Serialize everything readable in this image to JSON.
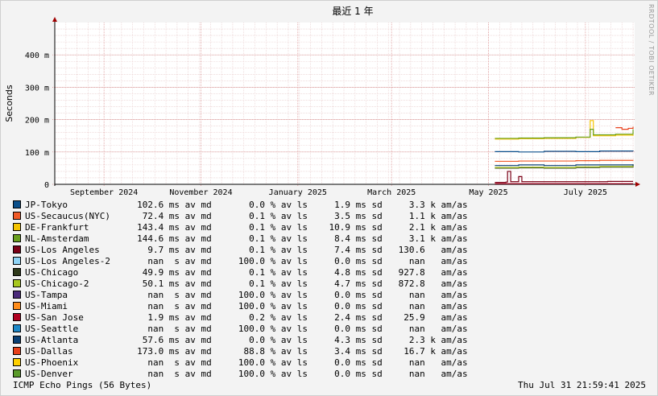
{
  "chart_data": {
    "type": "line",
    "title": "最近 1 年",
    "ylabel": "Seconds",
    "ylim": [
      0,
      0.5
    ],
    "ytick_labels": [
      "0",
      "100 m",
      "200 m",
      "300 m",
      "400 m"
    ],
    "ytick_values": [
      0,
      0.1,
      0.2,
      0.3,
      0.4
    ],
    "xlim": [
      "2024-08-01",
      "2025-08-01"
    ],
    "xtick_labels": [
      "September 2024",
      "November 2024",
      "January 2025",
      "March 2025",
      "May 2025",
      "July 2025"
    ],
    "xtick_dates": [
      "2024-09-01",
      "2024-11-01",
      "2025-01-01",
      "2025-03-01",
      "2025-05-01",
      "2025-07-01"
    ],
    "grid": true,
    "series": [
      {
        "name": "JP-Tokyo",
        "color": "#0b4f8a",
        "points": [
          [
            "2025-05-05",
            0.101
          ],
          [
            "2025-05-20",
            0.1
          ],
          [
            "2025-06-05",
            0.102
          ],
          [
            "2025-06-25",
            0.101
          ],
          [
            "2025-07-10",
            0.103
          ],
          [
            "2025-07-31",
            0.102
          ]
        ]
      },
      {
        "name": "US-Secaucus(NYC)",
        "color": "#f05a28",
        "points": [
          [
            "2025-05-05",
            0.071
          ],
          [
            "2025-05-20",
            0.072
          ],
          [
            "2025-06-05",
            0.072
          ],
          [
            "2025-06-25",
            0.073
          ],
          [
            "2025-07-10",
            0.074
          ],
          [
            "2025-07-31",
            0.073
          ]
        ]
      },
      {
        "name": "DE-Frankfurt",
        "color": "#f5c400",
        "points": [
          [
            "2025-05-05",
            0.14
          ],
          [
            "2025-05-20",
            0.141
          ],
          [
            "2025-06-05",
            0.142
          ],
          [
            "2025-06-25",
            0.145
          ],
          [
            "2025-07-04",
            0.197
          ],
          [
            "2025-07-06",
            0.15
          ],
          [
            "2025-07-20",
            0.152
          ],
          [
            "2025-07-31",
            0.15
          ]
        ]
      },
      {
        "name": "NL-Amsterdam",
        "color": "#6aa01e",
        "points": [
          [
            "2025-05-05",
            0.142
          ],
          [
            "2025-05-20",
            0.143
          ],
          [
            "2025-06-05",
            0.144
          ],
          [
            "2025-06-25",
            0.146
          ],
          [
            "2025-07-04",
            0.17
          ],
          [
            "2025-07-06",
            0.153
          ],
          [
            "2025-07-20",
            0.155
          ],
          [
            "2025-07-31",
            0.17
          ]
        ]
      },
      {
        "name": "US-Los Angeles",
        "color": "#7a0016",
        "points": [
          [
            "2025-05-05",
            0.006
          ],
          [
            "2025-05-12",
            0.007
          ],
          [
            "2025-05-13",
            0.04
          ],
          [
            "2025-05-15",
            0.008
          ],
          [
            "2025-05-20",
            0.024
          ],
          [
            "2025-05-22",
            0.008
          ],
          [
            "2025-06-15",
            0.008
          ],
          [
            "2025-07-15",
            0.009
          ],
          [
            "2025-07-31",
            0.009
          ]
        ]
      },
      {
        "name": "US-Los Angeles-2",
        "color": "#8fd3f5",
        "points": []
      },
      {
        "name": "US-Chicago",
        "color": "#2f3a1a",
        "points": [
          [
            "2025-05-05",
            0.05
          ],
          [
            "2025-05-20",
            0.051
          ],
          [
            "2025-06-05",
            0.05
          ],
          [
            "2025-06-25",
            0.052
          ],
          [
            "2025-07-10",
            0.053
          ],
          [
            "2025-07-31",
            0.062
          ]
        ]
      },
      {
        "name": "US-Chicago-2",
        "color": "#a8c81e",
        "points": [
          [
            "2025-05-05",
            0.052
          ],
          [
            "2025-05-20",
            0.053
          ],
          [
            "2025-06-05",
            0.052
          ],
          [
            "2025-06-25",
            0.054
          ],
          [
            "2025-07-10",
            0.055
          ],
          [
            "2025-07-31",
            0.056
          ]
        ]
      },
      {
        "name": "US-Tampa",
        "color": "#4b2a7a",
        "points": []
      },
      {
        "name": "US-Miami",
        "color": "#ff8c1a",
        "points": []
      },
      {
        "name": "US-San Jose",
        "color": "#b00020",
        "points": [
          [
            "2025-05-05",
            0.002
          ],
          [
            "2025-06-15",
            0.002
          ],
          [
            "2025-07-31",
            0.002
          ]
        ]
      },
      {
        "name": "US-Seattle",
        "color": "#1e88c8",
        "points": []
      },
      {
        "name": "US-Atlanta",
        "color": "#0a3f73",
        "points": [
          [
            "2025-05-05",
            0.058
          ],
          [
            "2025-05-20",
            0.06
          ],
          [
            "2025-06-05",
            0.058
          ],
          [
            "2025-06-25",
            0.06
          ],
          [
            "2025-07-31",
            0.058
          ]
        ]
      },
      {
        "name": "US-Dallas",
        "color": "#e8401a",
        "points": [
          [
            "2025-07-20",
            0.175
          ],
          [
            "2025-07-24",
            0.17
          ],
          [
            "2025-07-28",
            0.173
          ],
          [
            "2025-07-31",
            0.178
          ]
        ]
      },
      {
        "name": "US-Phoenix",
        "color": "#ffd000",
        "points": []
      },
      {
        "name": "US-Denver",
        "color": "#5a9a2a",
        "points": []
      }
    ]
  },
  "legend": {
    "rows": [
      {
        "name": "JP-Tokyo",
        "color": "#0b4f8a",
        "avg": "102.6",
        "avg_unit": "ms",
        "loss": "0.0",
        "sd": "1.9",
        "sd_unit": "ms",
        "amas": "3.3 k"
      },
      {
        "name": "US-Secaucus(NYC)",
        "color": "#f05a28",
        "avg": "72.4",
        "avg_unit": "ms",
        "loss": "0.1",
        "sd": "3.5",
        "sd_unit": "ms",
        "amas": "1.1 k"
      },
      {
        "name": "DE-Frankfurt",
        "color": "#f5c400",
        "avg": "143.4",
        "avg_unit": "ms",
        "loss": "0.1",
        "sd": "10.9",
        "sd_unit": "ms",
        "amas": "2.1 k"
      },
      {
        "name": "NL-Amsterdam",
        "color": "#6aa01e",
        "avg": "144.6",
        "avg_unit": "ms",
        "loss": "0.1",
        "sd": "8.4",
        "sd_unit": "ms",
        "amas": "3.1 k"
      },
      {
        "name": "US-Los Angeles",
        "color": "#7a0016",
        "avg": "9.7",
        "avg_unit": "ms",
        "loss": "0.1",
        "sd": "7.4",
        "sd_unit": "ms",
        "amas": "130.6  "
      },
      {
        "name": "US-Los Angeles-2",
        "color": "#8fd3f5",
        "avg": "nan",
        "avg_unit": " s",
        "loss": "100.0",
        "sd": "0.0",
        "sd_unit": "ms",
        "amas": "nan  "
      },
      {
        "name": "US-Chicago",
        "color": "#2f3a1a",
        "avg": "49.9",
        "avg_unit": "ms",
        "loss": "0.1",
        "sd": "4.8",
        "sd_unit": "ms",
        "amas": "927.8  "
      },
      {
        "name": "US-Chicago-2",
        "color": "#a8c81e",
        "avg": "50.1",
        "avg_unit": "ms",
        "loss": "0.1",
        "sd": "4.7",
        "sd_unit": "ms",
        "amas": "872.8  "
      },
      {
        "name": "US-Tampa",
        "color": "#4b2a7a",
        "avg": "nan",
        "avg_unit": " s",
        "loss": "100.0",
        "sd": "0.0",
        "sd_unit": "ms",
        "amas": "nan  "
      },
      {
        "name": "US-Miami",
        "color": "#ff8c1a",
        "avg": "nan",
        "avg_unit": " s",
        "loss": "100.0",
        "sd": "0.0",
        "sd_unit": "ms",
        "amas": "nan  "
      },
      {
        "name": "US-San Jose",
        "color": "#b00020",
        "avg": "1.9",
        "avg_unit": "ms",
        "loss": "0.2",
        "sd": "2.4",
        "sd_unit": "ms",
        "amas": "25.9  "
      },
      {
        "name": "US-Seattle",
        "color": "#1e88c8",
        "avg": "nan",
        "avg_unit": " s",
        "loss": "100.0",
        "sd": "0.0",
        "sd_unit": "ms",
        "amas": "nan  "
      },
      {
        "name": "US-Atlanta",
        "color": "#0a3f73",
        "avg": "57.6",
        "avg_unit": "ms",
        "loss": "0.0",
        "sd": "4.3",
        "sd_unit": "ms",
        "amas": "2.3 k"
      },
      {
        "name": "US-Dallas",
        "color": "#e8401a",
        "avg": "173.0",
        "avg_unit": "ms",
        "loss": "88.8",
        "sd": "3.4",
        "sd_unit": "ms",
        "amas": "16.7 k"
      },
      {
        "name": "US-Phoenix",
        "color": "#ffd000",
        "avg": "nan",
        "avg_unit": " s",
        "loss": "100.0",
        "sd": "0.0",
        "sd_unit": "ms",
        "amas": "nan  "
      },
      {
        "name": "US-Denver",
        "color": "#5a9a2a",
        "avg": "nan",
        "avg_unit": " s",
        "loss": "100.0",
        "sd": "0.0",
        "sd_unit": "ms",
        "amas": "nan  "
      }
    ],
    "label_avg": "av md",
    "label_loss": "% av ls",
    "label_sd": "sd",
    "label_amas": "am/as"
  },
  "footer": {
    "left": "ICMP Echo Pings (56 Bytes)",
    "right": "Thu Jul 31 21:59:41 2025"
  },
  "side_tag": "RRDTOOL / TOBI OETIKER"
}
